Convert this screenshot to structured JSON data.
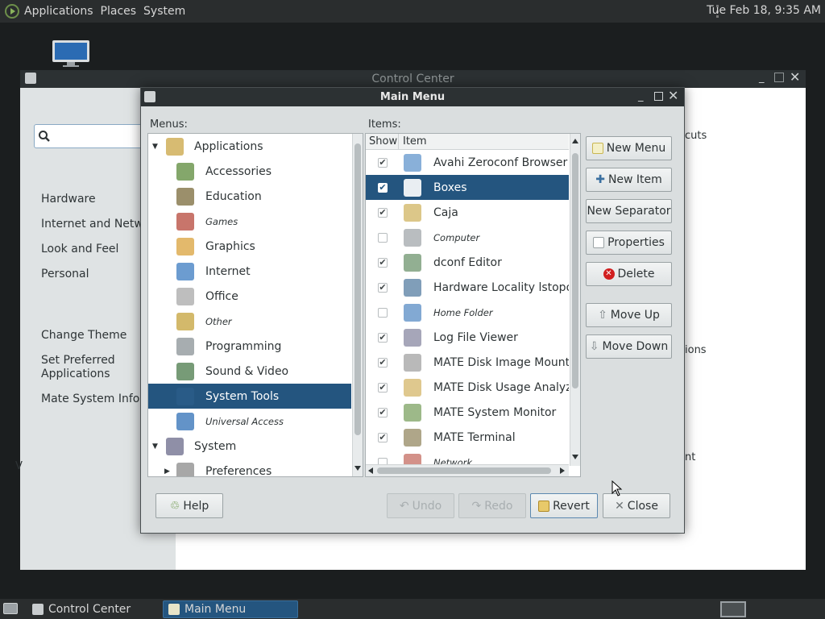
{
  "top_panel": {
    "menus": [
      "Applications",
      "Places",
      "System"
    ],
    "clock": "Tue Feb 18,  9:35 AM"
  },
  "control_center": {
    "title": "Control Center",
    "sidebar_groups": [
      "Hardware",
      "Internet and Networ",
      "Look and Feel",
      "Personal"
    ],
    "sidebar_actions": [
      "Change Theme",
      "Set Preferred Applications",
      "Mate System Info"
    ],
    "partial_right": [
      "cuts",
      "ions",
      "nt"
    ],
    "partial_left": "V"
  },
  "main_menu": {
    "title": "Main Menu",
    "menus_label": "Menus:",
    "items_label": "Items:",
    "tree": [
      {
        "label": "Applications",
        "level": 0,
        "expanded": true,
        "hidden": false,
        "selected": false,
        "icon": "applications-icon"
      },
      {
        "label": "Accessories",
        "level": 1,
        "hidden": false,
        "selected": false,
        "icon": "accessories-icon"
      },
      {
        "label": "Education",
        "level": 1,
        "hidden": false,
        "selected": false,
        "icon": "education-icon"
      },
      {
        "label": "Games",
        "level": 1,
        "hidden": true,
        "selected": false,
        "icon": "games-icon"
      },
      {
        "label": "Graphics",
        "level": 1,
        "hidden": false,
        "selected": false,
        "icon": "graphics-icon"
      },
      {
        "label": "Internet",
        "level": 1,
        "hidden": false,
        "selected": false,
        "icon": "internet-icon"
      },
      {
        "label": "Office",
        "level": 1,
        "hidden": false,
        "selected": false,
        "icon": "office-icon"
      },
      {
        "label": "Other",
        "level": 1,
        "hidden": true,
        "selected": false,
        "icon": "other-icon"
      },
      {
        "label": "Programming",
        "level": 1,
        "hidden": false,
        "selected": false,
        "icon": "programming-icon"
      },
      {
        "label": "Sound & Video",
        "level": 1,
        "hidden": false,
        "selected": false,
        "icon": "sound-video-icon"
      },
      {
        "label": "System Tools",
        "level": 1,
        "hidden": false,
        "selected": true,
        "icon": "system-tools-icon"
      },
      {
        "label": "Universal Access",
        "level": 1,
        "hidden": true,
        "selected": false,
        "icon": "universal-access-icon"
      },
      {
        "label": "System",
        "level": 0,
        "expanded": true,
        "hidden": false,
        "selected": false,
        "icon": "system-icon"
      },
      {
        "label": "Preferences",
        "level": 1,
        "expander": true,
        "hidden": false,
        "selected": false,
        "icon": "preferences-icon"
      }
    ],
    "columns": {
      "show": "Show",
      "item": "Item"
    },
    "items": [
      {
        "label": "Avahi Zeroconf Browser",
        "checked": true,
        "hidden": false,
        "selected": false,
        "icon": "avahi-icon"
      },
      {
        "label": "Boxes",
        "checked": true,
        "hidden": false,
        "selected": true,
        "icon": "boxes-icon"
      },
      {
        "label": "Caja",
        "checked": true,
        "hidden": false,
        "selected": false,
        "icon": "caja-icon"
      },
      {
        "label": "Computer",
        "checked": false,
        "hidden": true,
        "selected": false,
        "icon": "computer-icon"
      },
      {
        "label": "dconf Editor",
        "checked": true,
        "hidden": false,
        "selected": false,
        "icon": "dconf-icon"
      },
      {
        "label": "Hardware Locality lstopo",
        "checked": true,
        "hidden": false,
        "selected": false,
        "icon": "hardware-icon"
      },
      {
        "label": "Home Folder",
        "checked": false,
        "hidden": true,
        "selected": false,
        "icon": "home-folder-icon"
      },
      {
        "label": "Log File Viewer",
        "checked": true,
        "hidden": false,
        "selected": false,
        "icon": "log-viewer-icon"
      },
      {
        "label": "MATE Disk Image Mounter",
        "checked": true,
        "hidden": false,
        "selected": false,
        "icon": "disk-mounter-icon"
      },
      {
        "label": "MATE Disk Usage Analyzer",
        "checked": true,
        "hidden": false,
        "selected": false,
        "icon": "disk-usage-icon"
      },
      {
        "label": "MATE System Monitor",
        "checked": true,
        "hidden": false,
        "selected": false,
        "icon": "system-monitor-icon"
      },
      {
        "label": "MATE Terminal",
        "checked": true,
        "hidden": false,
        "selected": false,
        "icon": "terminal-icon"
      },
      {
        "label": "Network",
        "checked": false,
        "hidden": true,
        "selected": false,
        "icon": "network-icon"
      }
    ],
    "side_buttons": {
      "new_menu": "New Menu",
      "new_item": "New Item",
      "new_separator": "New Separator",
      "properties": "Properties",
      "delete": "Delete",
      "move_up": "Move Up",
      "move_down": "Move Down"
    },
    "bottom_buttons": {
      "help": "Help",
      "undo": "Undo",
      "redo": "Redo",
      "revert": "Revert",
      "close": "Close"
    }
  },
  "taskbar": {
    "tasks": [
      {
        "label": "Control Center",
        "active": false
      },
      {
        "label": "Main Menu",
        "active": true
      }
    ]
  },
  "colors": {
    "selection": "#24557f",
    "titlebar": "#2c3133",
    "panel": "#2a2d2e"
  }
}
